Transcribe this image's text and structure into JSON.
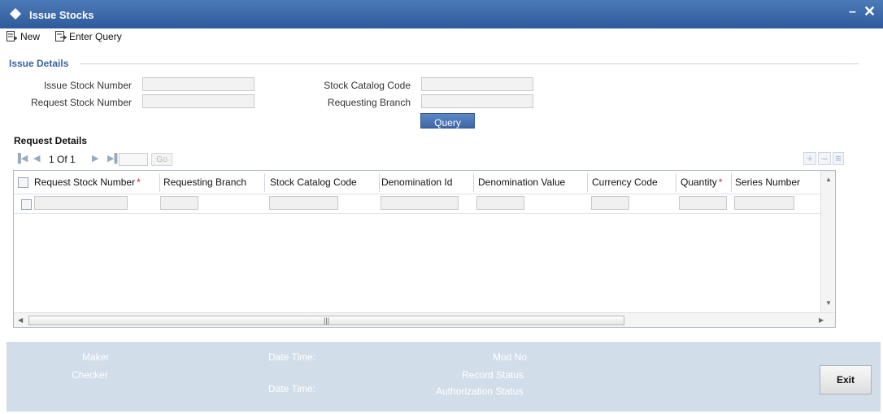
{
  "window": {
    "title": "Issue Stocks"
  },
  "toolbar": {
    "new_label": "New",
    "enter_query_label": "Enter Query"
  },
  "issue_details": {
    "section_title": "Issue Details",
    "issue_stock_number_label": "Issue Stock Number",
    "issue_stock_number_value": "",
    "request_stock_number_label": "Request Stock Number",
    "request_stock_number_value": "",
    "stock_catalog_code_label": "Stock Catalog Code",
    "stock_catalog_code_value": "",
    "requesting_branch_label": "Requesting Branch",
    "requesting_branch_value": "",
    "query_button_label": "Query"
  },
  "request_details": {
    "section_title": "Request Details",
    "pagination": {
      "text": "1 Of 1",
      "go_label": "Go"
    },
    "columns": [
      {
        "label": "Request Stock Number",
        "required": true
      },
      {
        "label": "Requesting Branch",
        "required": false
      },
      {
        "label": "Stock Catalog Code",
        "required": false
      },
      {
        "label": "Denomination Id",
        "required": false
      },
      {
        "label": "Denomination Value",
        "required": false
      },
      {
        "label": "Currency Code",
        "required": false
      },
      {
        "label": "Quantity",
        "required": true
      },
      {
        "label": "Series Number",
        "required": false
      }
    ],
    "required_marker": "*",
    "rows": [
      {
        "checked": false,
        "cells": [
          "",
          "",
          "",
          "",
          "",
          "",
          "",
          ""
        ]
      }
    ]
  },
  "footer": {
    "maker_label": "Maker",
    "checker_label": "Checker",
    "date_time_label_1": "Date Time:",
    "date_time_label_2": "Date Time:",
    "mod_no_label": "Mod No",
    "record_status_label": "Record Status",
    "authorization_status_label": "Authorization Status",
    "exit_label": "Exit"
  },
  "colors": {
    "titlebar": "#3a66a8",
    "section_title": "#3a63a0",
    "required_marker": "#d42020",
    "footer_bg": "#d2ddea"
  }
}
